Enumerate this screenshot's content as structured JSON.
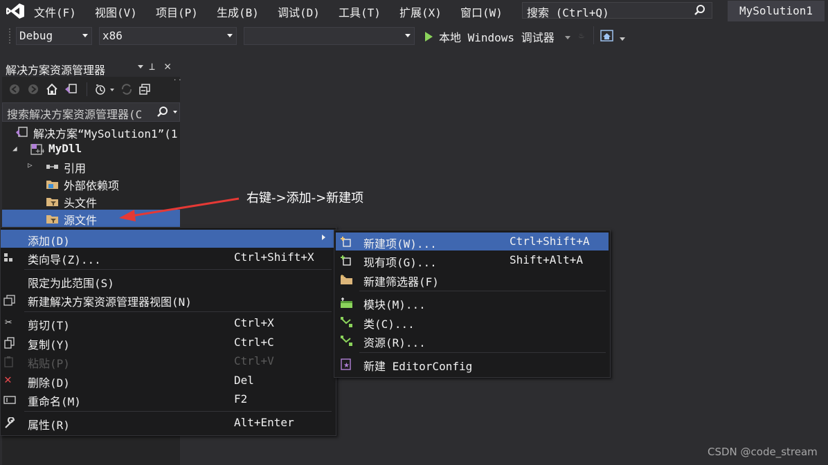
{
  "menubar": {
    "items": [
      "文件(F)",
      "视图(V)",
      "项目(P)",
      "生成(B)",
      "调试(D)",
      "工具(T)",
      "扩展(X)",
      "窗口(W)"
    ],
    "search_label": "搜索 (Ctrl+Q)",
    "solution_title": "MySolution1"
  },
  "toolbar": {
    "config": "Debug",
    "platform": "x86",
    "startup": "",
    "debugger_label": "本地 Windows 调试器"
  },
  "solution_explorer": {
    "title": "解决方案资源管理器",
    "search_placeholder": "搜索解决方案资源管理器(C",
    "tree": [
      "解决方案“MySolution1”(1",
      "MyDll",
      "引用",
      "外部依赖项",
      "头文件",
      "源文件"
    ]
  },
  "context_menu": {
    "items": [
      {
        "label": "添加(D)",
        "shortcut": ""
      },
      {
        "label": "类向导(Z)...",
        "shortcut": "Ctrl+Shift+X"
      },
      {
        "label": "限定为此范围(S)",
        "shortcut": ""
      },
      {
        "label": "新建解决方案资源管理器视图(N)",
        "shortcut": ""
      },
      {
        "label": "剪切(T)",
        "shortcut": "Ctrl+X"
      },
      {
        "label": "复制(Y)",
        "shortcut": "Ctrl+C"
      },
      {
        "label": "粘贴(P)",
        "shortcut": "Ctrl+V"
      },
      {
        "label": "删除(D)",
        "shortcut": "Del"
      },
      {
        "label": "重命名(M)",
        "shortcut": "F2"
      },
      {
        "label": "属性(R)",
        "shortcut": "Alt+Enter"
      }
    ]
  },
  "submenu": {
    "items": [
      {
        "label": "新建项(W)...",
        "shortcut": "Ctrl+Shift+A"
      },
      {
        "label": "现有项(G)...",
        "shortcut": "Shift+Alt+A"
      },
      {
        "label": "新建筛选器(F)",
        "shortcut": ""
      },
      {
        "label": "模块(M)...",
        "shortcut": ""
      },
      {
        "label": "类(C)...",
        "shortcut": ""
      },
      {
        "label": "资源(R)...",
        "shortcut": ""
      },
      {
        "label": "新建 EditorConfig",
        "shortcut": ""
      }
    ]
  },
  "annotation": "右键->添加->新建项",
  "watermark": "CSDN @code_stream"
}
